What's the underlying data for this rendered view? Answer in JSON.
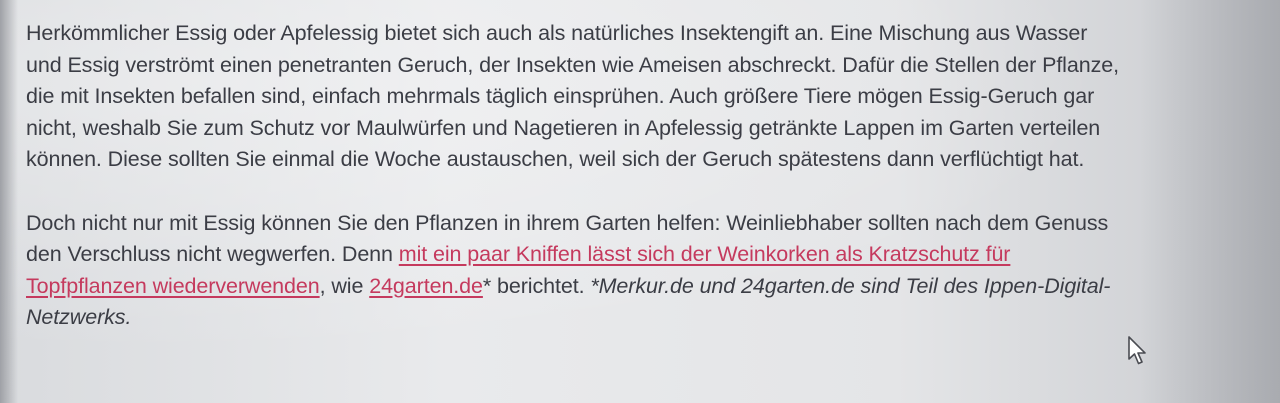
{
  "article": {
    "paragraph1": "Herkömmlicher Essig oder Apfelessig bietet sich auch als natürliches Insektengift an. Eine Mischung aus Wasser und Essig verströmt einen penetranten Geruch, der Insekten wie Ameisen abschreckt. Dafür die Stellen der Pflanze, die mit Insekten befallen sind, einfach mehrmals täglich einsprühen. Auch größere Tiere mögen Essig-Geruch gar nicht, weshalb Sie zum Schutz vor Maulwürfen und Nagetieren in Apfelessig getränkte Lappen im Garten verteilen können. Diese sollten Sie einmal die Woche austauschen, weil sich der Geruch spätestens dann verflüchtigt hat.",
    "paragraph2": {
      "intro": "Doch nicht nur mit Essig können Sie den Pflanzen in ihrem Garten helfen: Weinliebhaber sollten nach dem Genuss den Verschluss nicht wegwerfen. Denn ",
      "link1": "mit ein paar Kniffen lässt sich der Weinkorken als Kratzschutz für Topfpflanzen wiederverwenden",
      "mid": ", wie ",
      "link2": "24garten.de",
      "after": "* berichtet. ",
      "note": "*Merkur.de und 24garten.de sind Teil des Ippen-Digital-Netzwerks."
    }
  },
  "colors": {
    "text": "#3b3d45",
    "link": "#c53a5e"
  },
  "icons": {
    "cursor": "mouse-pointer-icon"
  }
}
